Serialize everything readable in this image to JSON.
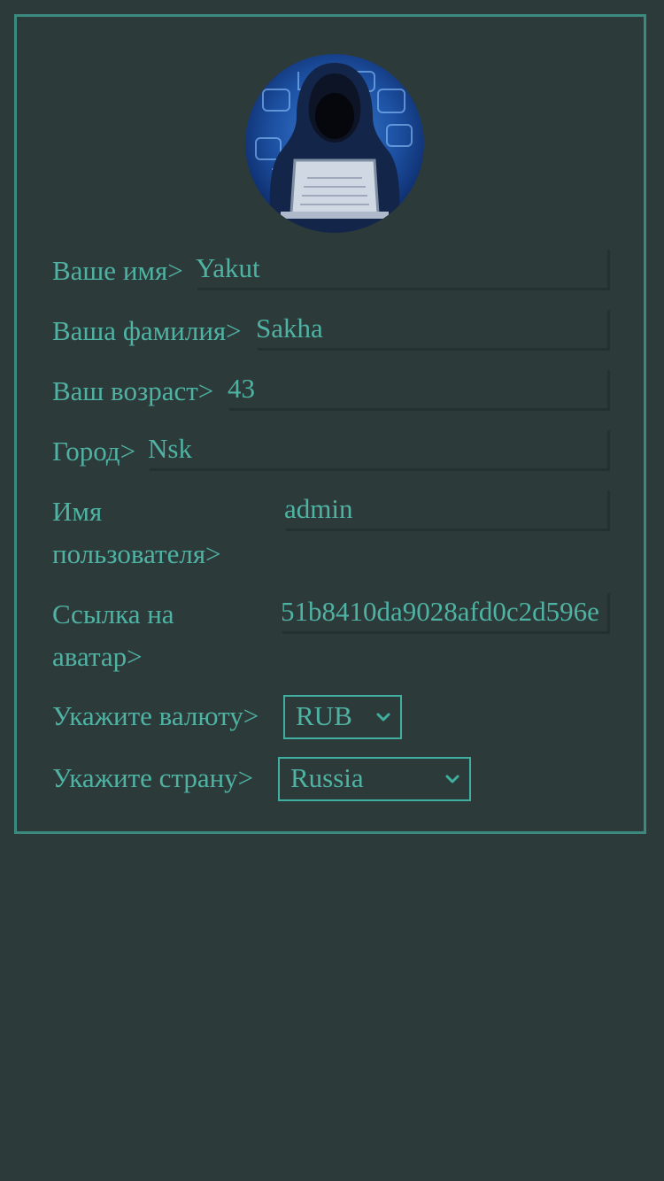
{
  "profile": {
    "first_name": {
      "label": "Ваше имя>",
      "value": "Yakut"
    },
    "last_name": {
      "label": "Ваша фамилия>",
      "value": "Sakha"
    },
    "age": {
      "label": "Ваш возраст>",
      "value": "43"
    },
    "city": {
      "label": "Город>",
      "value": "Nsk"
    },
    "username": {
      "label": "Имя пользователя>",
      "value": "admin"
    },
    "avatar_link": {
      "label": "Ссылка на аватар>",
      "value": "51b8410da9028afd0c2d596e"
    },
    "currency": {
      "label": "Укажите валюту>",
      "selected": "RUB"
    },
    "country": {
      "label": "Укажите страну>",
      "selected": "Russia"
    }
  },
  "icons": {
    "avatar": "hooded-hacker-avatar",
    "dropdown": "chevron-down-icon"
  },
  "colors": {
    "background": "#2d3a3a",
    "accent": "#3a8a80",
    "text": "#4fb3a4"
  }
}
